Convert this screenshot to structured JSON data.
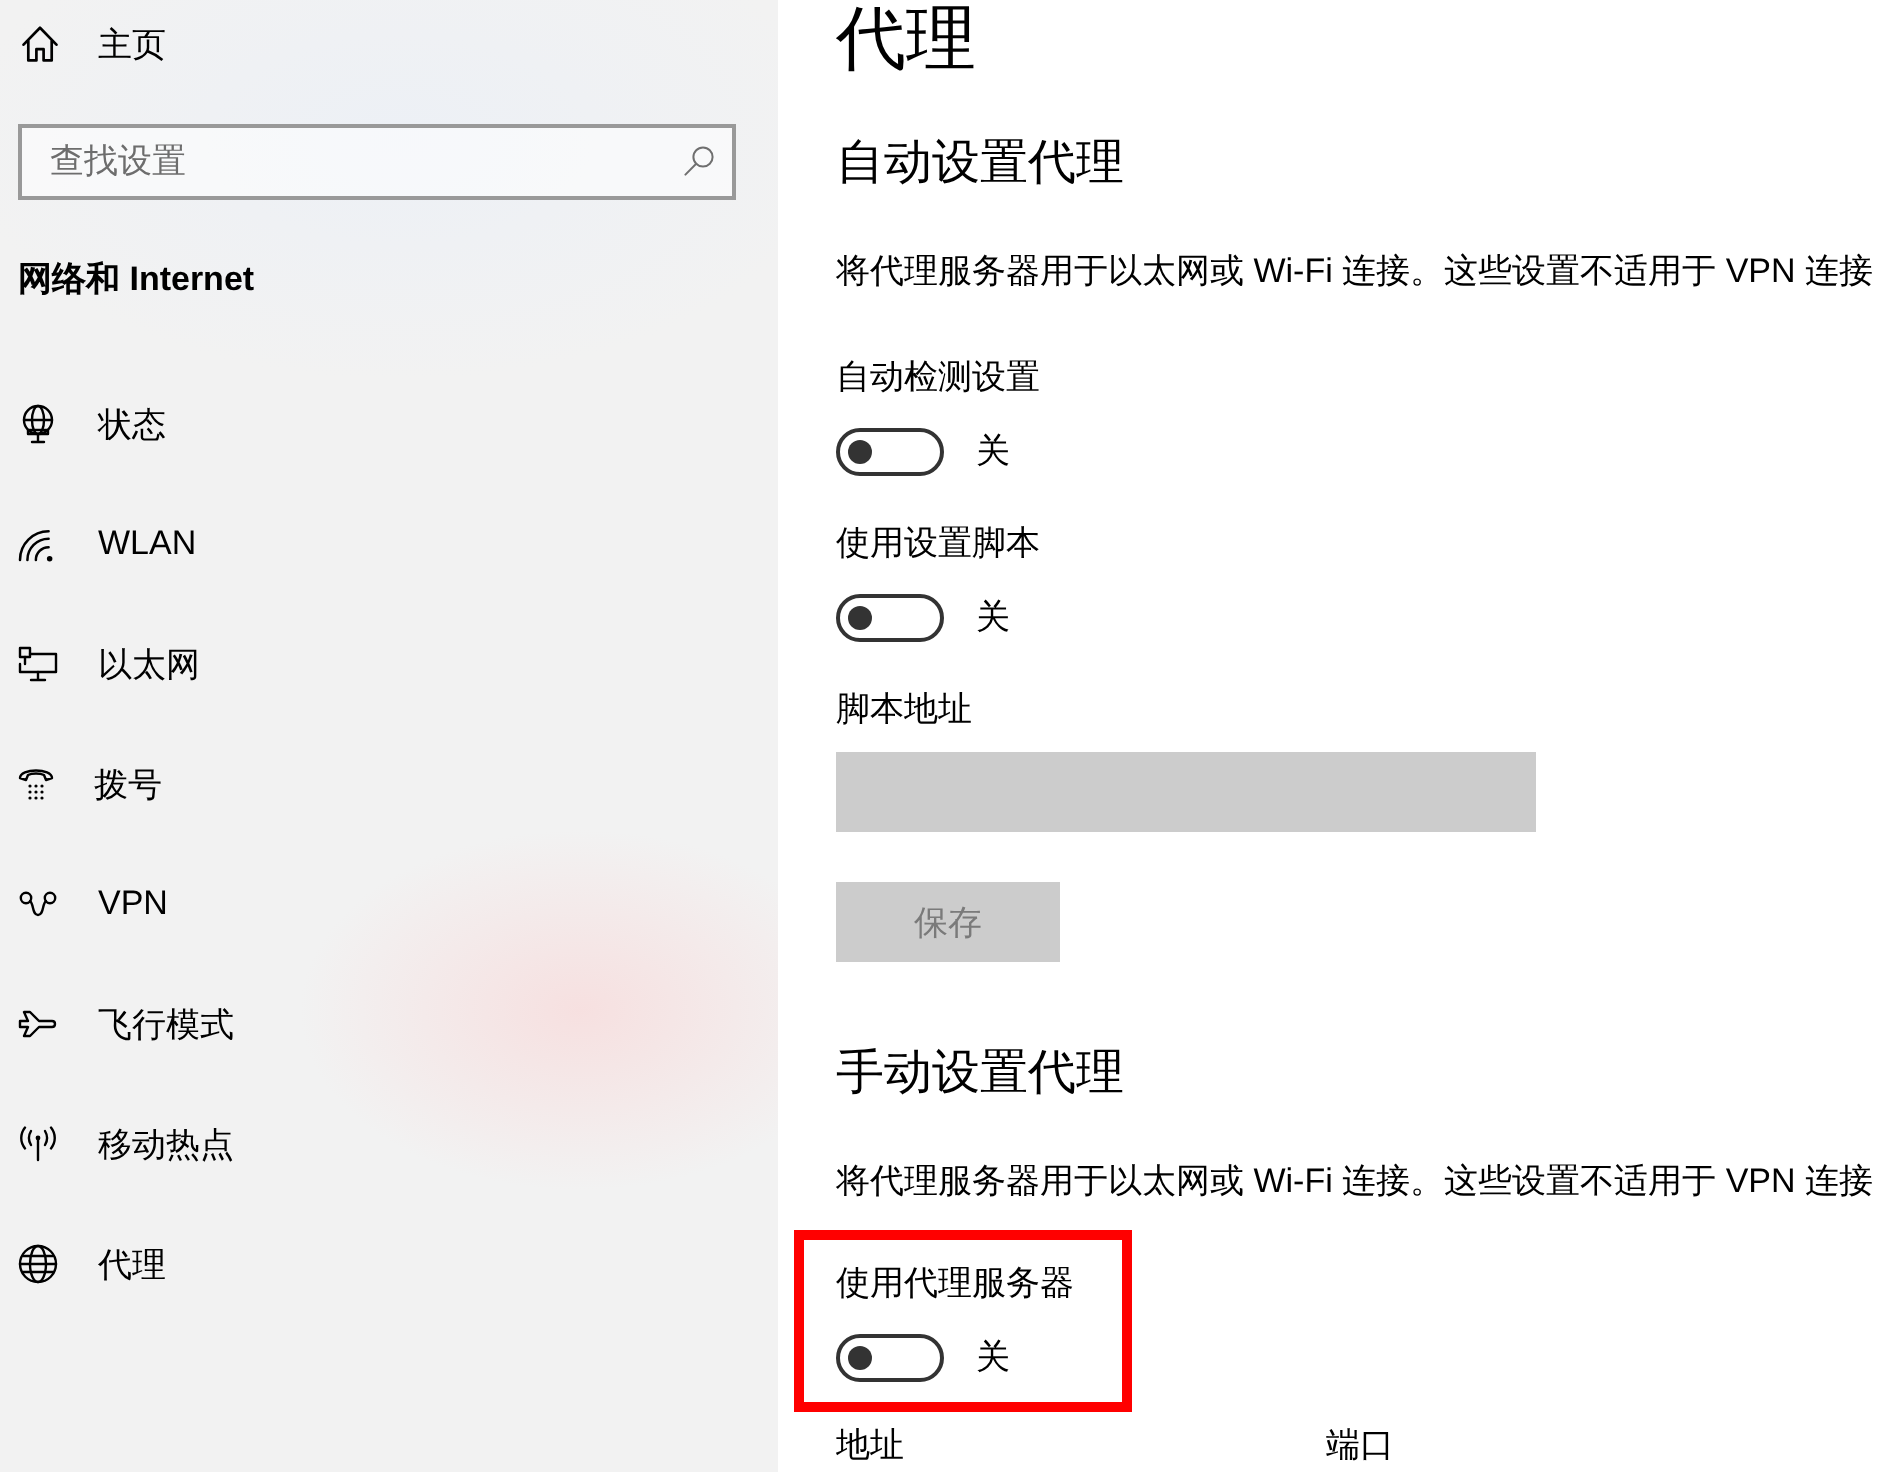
{
  "sidebar": {
    "home": {
      "label": "主页"
    },
    "search": {
      "placeholder": "查找设置"
    },
    "section_title": "网络和 Internet",
    "items": [
      {
        "kind": "status",
        "label": "状态"
      },
      {
        "kind": "wlan",
        "label": "WLAN"
      },
      {
        "kind": "ethernet",
        "label": "以太网"
      },
      {
        "kind": "dialup",
        "label": "拨号"
      },
      {
        "kind": "vpn",
        "label": "VPN"
      },
      {
        "kind": "airplane",
        "label": "飞行模式"
      },
      {
        "kind": "hotspot",
        "label": "移动热点"
      },
      {
        "kind": "proxy",
        "label": "代理"
      }
    ]
  },
  "page_title": "代理",
  "sections": [
    {
      "heading": "自动设置代理",
      "description": "将代理服务器用于以太网或 Wi-Fi 连接。这些设置不适用于 VPN 连接",
      "controls": [
        {
          "kind": "toggle",
          "label": "自动检测设置",
          "on": false,
          "state_text": "关",
          "highlighted": false
        },
        {
          "kind": "toggle",
          "label": "使用设置脚本",
          "on": false,
          "state_text": "关",
          "highlighted": false
        },
        {
          "kind": "text_field",
          "label": "脚本地址",
          "disabled": true
        },
        {
          "kind": "button",
          "label": "保存",
          "disabled": true
        }
      ]
    },
    {
      "heading": "手动设置代理",
      "description": "将代理服务器用于以太网或 Wi-Fi 连接。这些设置不适用于 VPN 连接",
      "controls": [
        {
          "kind": "toggle",
          "label": "使用代理服务器",
          "on": false,
          "state_text": "关",
          "highlighted": true
        },
        {
          "kind": "field_labels",
          "labels": [
            "地址",
            "端口"
          ]
        }
      ]
    }
  ]
}
